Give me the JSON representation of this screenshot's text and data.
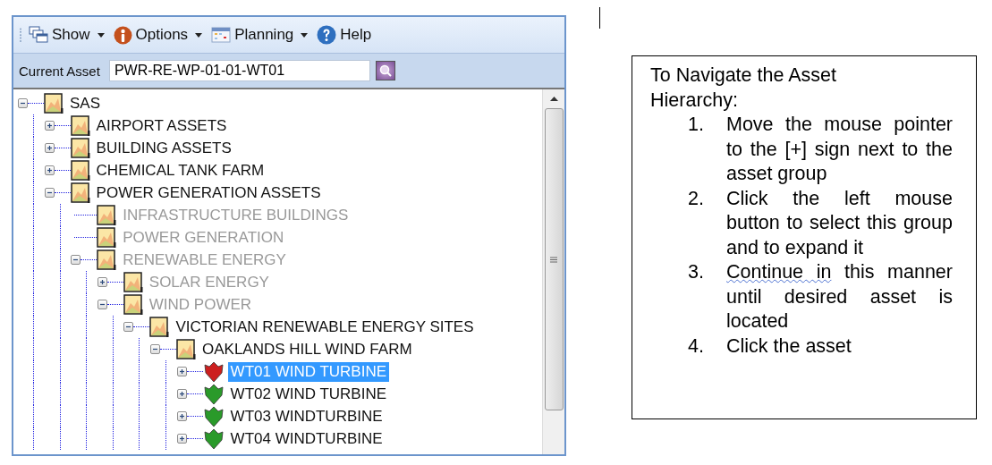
{
  "toolbar": [
    {
      "label": "Show",
      "dropdown": true
    },
    {
      "label": "Options",
      "dropdown": true
    },
    {
      "label": "Planning",
      "dropdown": true
    },
    {
      "label": "Help",
      "dropdown": false
    }
  ],
  "current_asset": {
    "label": "Current Asset",
    "value": "PWR-RE-WP-01-01-WT01"
  },
  "tree": [
    {
      "label": "SAS",
      "kind": "folder",
      "expandable": true,
      "expanded": true,
      "dimmed": false,
      "selected": false,
      "children": [
        {
          "label": "AIRPORT ASSETS",
          "kind": "folder",
          "expandable": true,
          "expanded": false,
          "dimmed": false,
          "selected": false
        },
        {
          "label": "BUILDING ASSETS",
          "kind": "folder",
          "expandable": true,
          "expanded": false,
          "dimmed": false,
          "selected": false
        },
        {
          "label": "CHEMICAL TANK FARM",
          "kind": "folder",
          "expandable": true,
          "expanded": false,
          "dimmed": false,
          "selected": false
        },
        {
          "label": "POWER GENERATION ASSETS",
          "kind": "folder",
          "expandable": true,
          "expanded": true,
          "dimmed": false,
          "selected": false,
          "children": [
            {
              "label": "INFRASTRUCTURE BUILDINGS",
              "kind": "folder",
              "expandable": false,
              "dimmed": true,
              "selected": false
            },
            {
              "label": "POWER GENERATION",
              "kind": "folder",
              "expandable": false,
              "dimmed": true,
              "selected": false
            },
            {
              "label": "RENEWABLE ENERGY",
              "kind": "folder",
              "expandable": true,
              "expanded": true,
              "dimmed": true,
              "selected": false,
              "children": [
                {
                  "label": "SOLAR ENERGY",
                  "kind": "folder",
                  "expandable": true,
                  "expanded": false,
                  "dimmed": true,
                  "selected": false
                },
                {
                  "label": "WIND POWER",
                  "kind": "folder",
                  "expandable": true,
                  "expanded": true,
                  "dimmed": true,
                  "selected": false,
                  "children": [
                    {
                      "label": "VICTORIAN RENEWABLE ENERGY SITES",
                      "kind": "folder",
                      "expandable": true,
                      "expanded": true,
                      "dimmed": false,
                      "selected": false,
                      "children": [
                        {
                          "label": "OAKLANDS HILL WIND FARM",
                          "kind": "folder",
                          "expandable": true,
                          "expanded": true,
                          "dimmed": false,
                          "selected": false,
                          "children": [
                            {
                              "label": "WT01 WIND TURBINE",
                              "kind": "asset",
                              "color": "#cc1f1f",
                              "expandable": true,
                              "expanded": false,
                              "dimmed": false,
                              "selected": true
                            },
                            {
                              "label": "WT02 WIND TURBINE",
                              "kind": "asset",
                              "color": "#2a9a2a",
                              "expandable": true,
                              "expanded": false,
                              "dimmed": false,
                              "selected": false
                            },
                            {
                              "label": "WT03 WINDTURBINE",
                              "kind": "asset",
                              "color": "#2a9a2a",
                              "expandable": true,
                              "expanded": false,
                              "dimmed": false,
                              "selected": false
                            },
                            {
                              "label": "WT04 WINDTURBINE",
                              "kind": "asset",
                              "color": "#2a9a2a",
                              "expandable": true,
                              "expanded": false,
                              "dimmed": false,
                              "selected": false
                            }
                          ]
                        }
                      ]
                    }
                  ]
                }
              ]
            }
          ]
        }
      ]
    }
  ],
  "instructions": {
    "title": "To Navigate the Asset Hierarchy:",
    "steps": [
      {
        "number": "1.",
        "text": "Move the mouse pointer to the [+] sign next to the asset group"
      },
      {
        "number": "2.",
        "text": "Click the left mouse button to select this group and to expand it"
      },
      {
        "number": "3.",
        "marked": "Continue  in",
        "text": " this manner until desired asset is located"
      },
      {
        "number": "4.",
        "text": "Click the asset"
      }
    ]
  }
}
